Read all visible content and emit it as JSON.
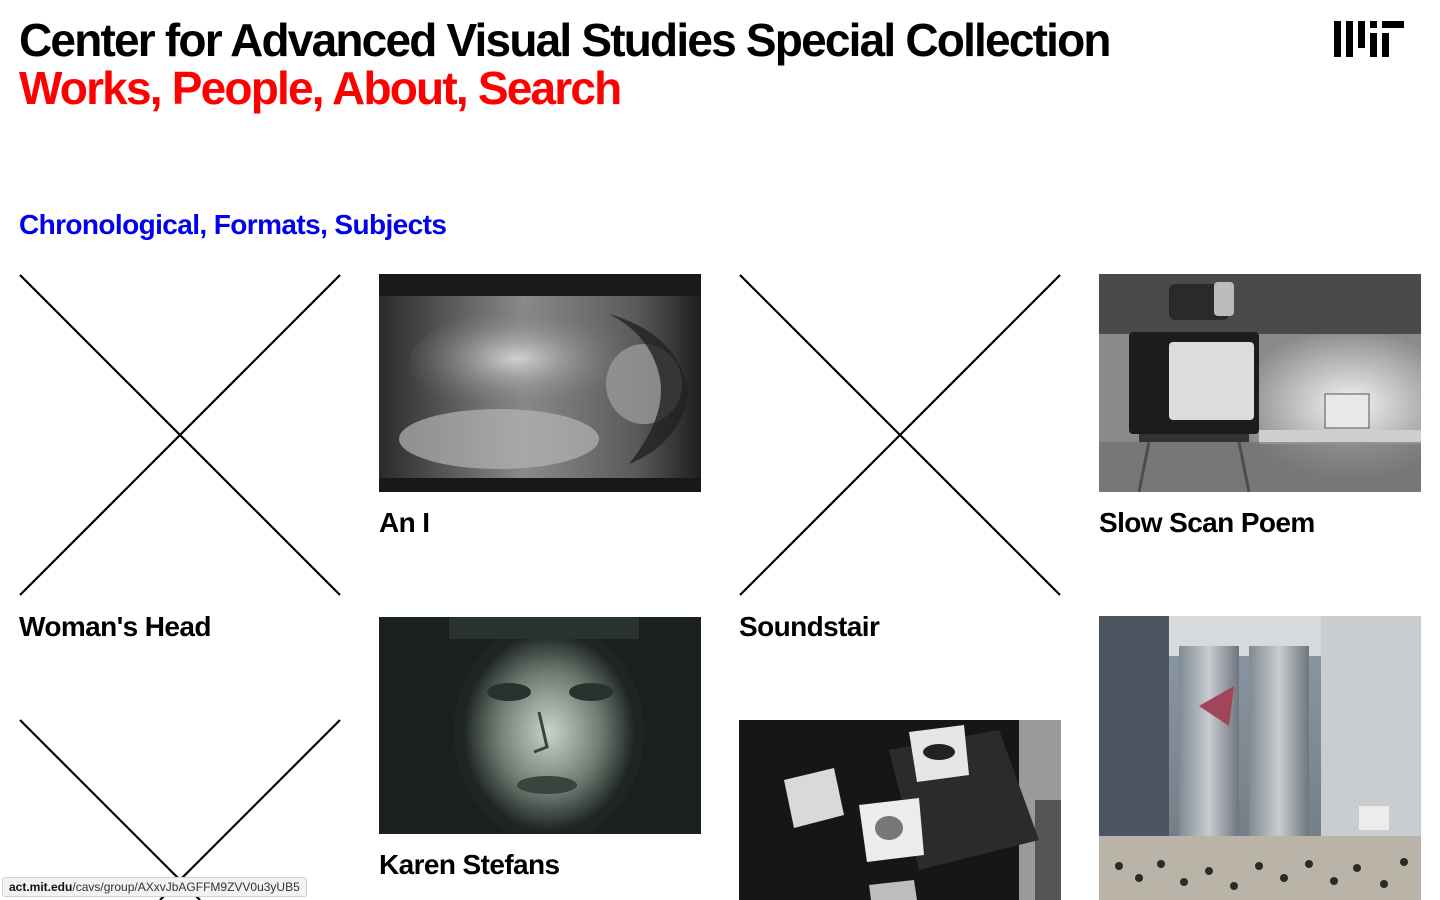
{
  "header": {
    "title": "Center for Advanced Visual Studies Special Collection",
    "nav": [
      {
        "label": "Works"
      },
      {
        "label": "People"
      },
      {
        "label": "About"
      },
      {
        "label": "Search"
      }
    ],
    "logo_icon": "mit-logo-icon"
  },
  "subnav": [
    {
      "label": "Chronological"
    },
    {
      "label": "Formats"
    },
    {
      "label": "Subjects"
    }
  ],
  "works": [
    {
      "title": "Woman's Head",
      "thumbnail": "placeholder-x-icon"
    },
    {
      "title": "An I",
      "thumbnail": "photo-reclining-figure"
    },
    {
      "title": "Soundstair",
      "thumbnail": "placeholder-x-icon"
    },
    {
      "title": "Slow Scan Poem",
      "thumbnail": "photo-tv-monitor-installation"
    },
    {
      "title": "Karen Stefans",
      "thumbnail": "photo-face-portrait"
    },
    {
      "title": "",
      "thumbnail": "placeholder-x-icon"
    },
    {
      "title": "",
      "thumbnail": "photo-monitors-eyes"
    },
    {
      "title": "",
      "thumbnail": "photo-museum-hall"
    }
  ],
  "status_bar": {
    "host": "act.mit.edu",
    "path": "/cavs/group/AXxvJbAGFFM9ZVV0u3yUB5"
  },
  "colors": {
    "nav": "#ff0000",
    "subnav": "#0000ee",
    "text": "#000000",
    "background": "#ffffff"
  }
}
